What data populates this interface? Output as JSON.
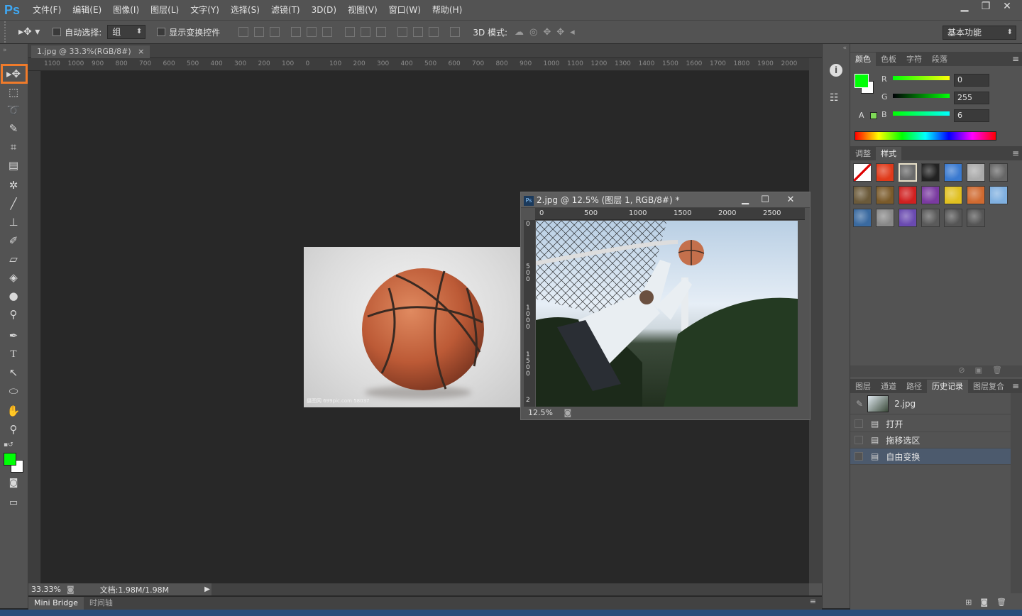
{
  "app": {
    "logo": "Ps"
  },
  "menu": [
    "文件(F)",
    "编辑(E)",
    "图像(I)",
    "图层(L)",
    "文字(Y)",
    "选择(S)",
    "滤镜(T)",
    "3D(D)",
    "视图(V)",
    "窗口(W)",
    "帮助(H)"
  ],
  "options": {
    "auto_select_label": "自动选择:",
    "auto_select_value": "组",
    "show_transform_label": "显示变换控件",
    "mode_3d_label": "3D 模式:",
    "workspace": "基本功能"
  },
  "doc1": {
    "tab_title": "1.jpg @ 33.3%(RGB/8#)",
    "ruler_ticks": [
      "1100",
      "1000",
      "900",
      "800",
      "700",
      "600",
      "500",
      "400",
      "300",
      "200",
      "100",
      "0",
      "100",
      "200",
      "300",
      "400",
      "500",
      "600",
      "700",
      "800",
      "900",
      "1000",
      "1100",
      "1200",
      "1300",
      "1400",
      "1500",
      "1600",
      "1700",
      "1800",
      "1900",
      "2000"
    ],
    "zoom": "33.33%",
    "doc_info": "文档:1.98M/1.98M",
    "watermark": "摄图网 699pic.com 58037"
  },
  "doc2": {
    "title": "2.jpg @ 12.5% (图层 1, RGB/8#) *",
    "ruler_ticks": [
      "0",
      "500",
      "1000",
      "1500",
      "2000",
      "2500"
    ],
    "vruler": [
      "0",
      "5\n0\n0",
      "1\n0\n0\n0",
      "1\n5\n0\n0",
      "2"
    ],
    "zoom": "12.5%"
  },
  "bottom_tabs": [
    "Mini Bridge",
    "时间轴"
  ],
  "color_panel": {
    "tabs": [
      "颜色",
      "色板",
      "字符",
      "段落"
    ],
    "r_label": "R",
    "g_label": "G",
    "b_label": "B",
    "r": "0",
    "g": "255",
    "b": "6",
    "fg": "#00ff06",
    "bg": "#ffffff"
  },
  "styles_panel": {
    "tabs": [
      "调整",
      "样式"
    ]
  },
  "history_panel": {
    "tabs": [
      "图层",
      "通道",
      "路径",
      "历史记录",
      "图层复合"
    ],
    "snapshot": "2.jpg",
    "states": [
      "打开",
      "拖移选区",
      "自由变换"
    ]
  },
  "icons": {
    "move": "move-tool-icon"
  }
}
